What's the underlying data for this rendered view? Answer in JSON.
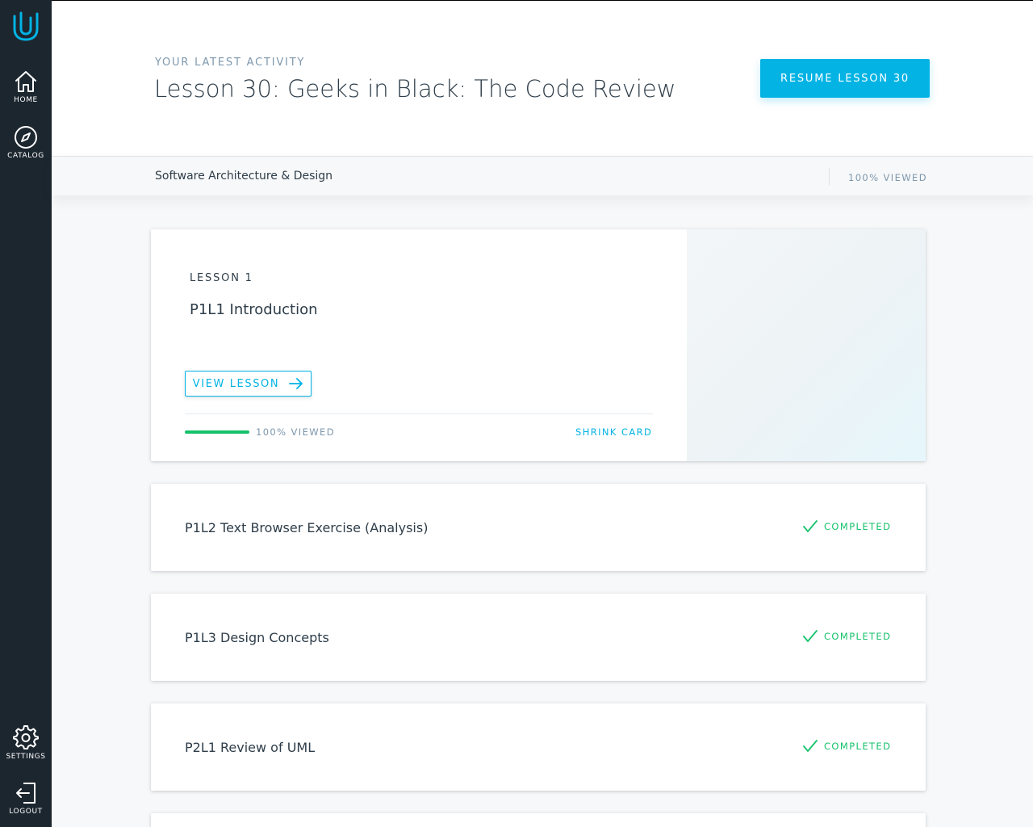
{
  "sidebar": {
    "logo": "udacity-logo-icon",
    "items": [
      {
        "label": "HOME",
        "icon": "home-icon"
      },
      {
        "label": "CATALOG",
        "icon": "compass-icon"
      },
      {
        "label": "SETTINGS",
        "icon": "gear-icon"
      },
      {
        "label": "LOGOUT",
        "icon": "logout-icon"
      }
    ]
  },
  "header": {
    "eyebrow": "YOUR LATEST ACTIVITY",
    "title": "Lesson 30: Geeks in Black: The Code Review",
    "resume_label": "RESUME LESSON 30"
  },
  "subbar": {
    "course": "Software Architecture & Design",
    "viewed": "100% VIEWED"
  },
  "featured": {
    "lesson_number": "LESSON 1",
    "title": "P1L1 Introduction",
    "view_label": "VIEW LESSON",
    "progress": 1.0,
    "viewed": "100% VIEWED",
    "shrink_label": "SHRINK CARD"
  },
  "lessons": [
    {
      "title": "P1L2 Text Browser Exercise (Analysis)",
      "status": "COMPLETED"
    },
    {
      "title": "P1L3 Design Concepts",
      "status": "COMPLETED"
    },
    {
      "title": "P2L1 Review of UML",
      "status": "COMPLETED"
    }
  ],
  "colors": {
    "accent": "#02b3e4",
    "success": "#15c26b",
    "sidebar": "#1c262f",
    "text": "#2e3d49",
    "muted": "#7d97ad"
  }
}
